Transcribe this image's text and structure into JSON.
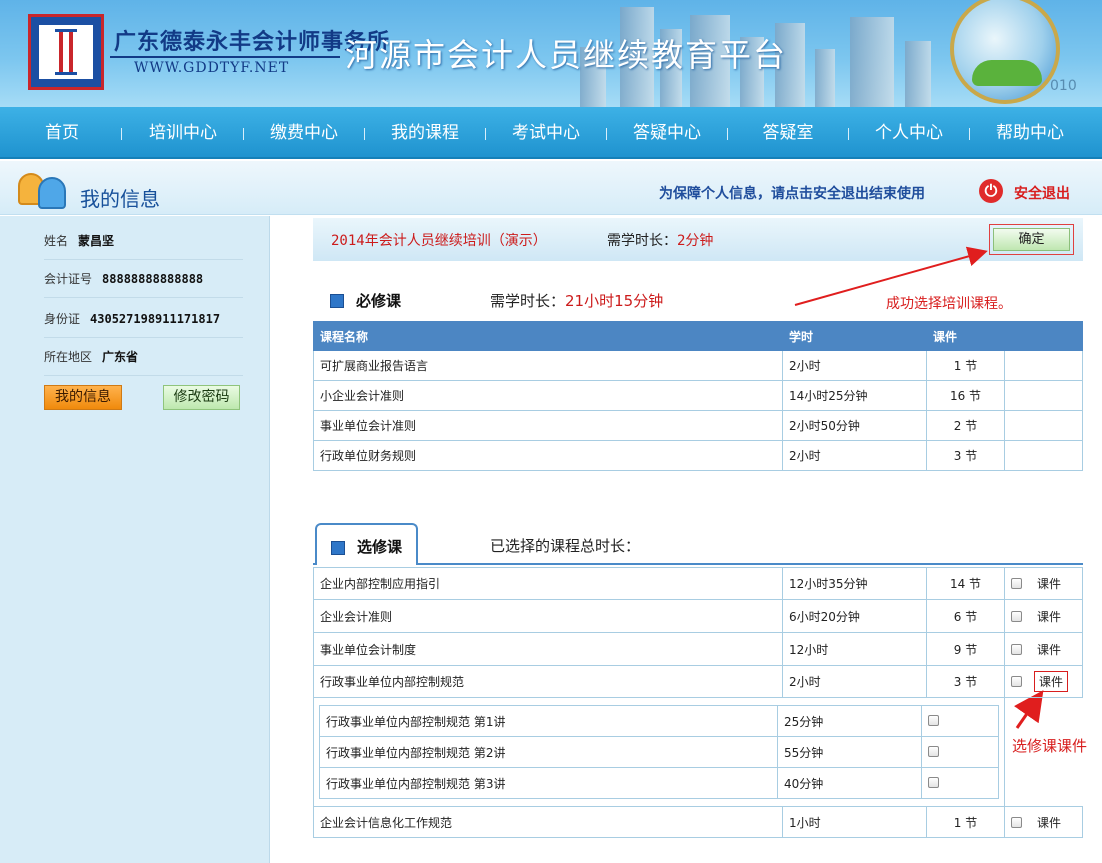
{
  "banner": {
    "company": "广东德泰永丰会计师事务所",
    "url": "WWW.GDDTYF.NET",
    "site_title": "河源市会计人员继续教育平台",
    "year_text": "010"
  },
  "nav": [
    "首页",
    "培训中心",
    "缴费中心",
    "我的课程",
    "考试中心",
    "答疑中心",
    "答疑室",
    "个人中心",
    "帮助中心"
  ],
  "header": {
    "title": "我的信息",
    "safe_tip": "为保障个人信息，请点击安全退出结束使用",
    "logout": "安全退出"
  },
  "profile": {
    "name_label": "姓名",
    "name": "蒙昌坚",
    "cert_label": "会计证号",
    "cert": "88888888888888",
    "id_label": "身份证",
    "id": "430527198911171817",
    "region_label": "所在地区",
    "region": "广东省",
    "btn_info": "我的信息",
    "btn_pwd": "修改密码"
  },
  "course": {
    "name": "2014年会计人员继续培训（演示）",
    "req_label": "需学时长：",
    "req_value": "2分钟",
    "confirm": "确定"
  },
  "required": {
    "title": "必修课",
    "req_label": "需学时长：",
    "req_value": "21小时15分钟",
    "headers": [
      "课程名称",
      "学时",
      "课件",
      ""
    ],
    "rows": [
      {
        "name": "可扩展商业报告语言",
        "hours": "2小时",
        "lessons": "1  节"
      },
      {
        "name": "小企业会计准则",
        "hours": "14小时25分钟",
        "lessons": "16  节"
      },
      {
        "name": "事业单位会计准则",
        "hours": "2小时50分钟",
        "lessons": "2  节"
      },
      {
        "name": "行政单位财务规则",
        "hours": "2小时",
        "lessons": "3  节"
      }
    ]
  },
  "annotations": {
    "success": "成功选择培训课程。",
    "elective": "选修课课件"
  },
  "elective": {
    "title": "选修课",
    "selected_label": "已选择的课程总时长：",
    "courseware": "课件",
    "rows": [
      {
        "name": "企业内部控制应用指引",
        "hours": "12小时35分钟",
        "lessons": "14 节"
      },
      {
        "name": "企业会计准则",
        "hours": "6小时20分钟",
        "lessons": "6 节"
      },
      {
        "name": "事业单位会计制度",
        "hours": "12小时",
        "lessons": "9 节"
      },
      {
        "name": "行政事业单位内部控制规范",
        "hours": "2小时",
        "lessons": "3 节"
      }
    ],
    "sub_rows": [
      {
        "name": "行政事业单位内部控制规范 第1讲",
        "duration": "25分钟"
      },
      {
        "name": "行政事业单位内部控制规范 第2讲",
        "duration": "55分钟"
      },
      {
        "name": "行政事业单位内部控制规范 第3讲",
        "duration": "40分钟"
      }
    ],
    "last_row": {
      "name": "企业会计信息化工作规范",
      "hours": "1小时",
      "lessons": "1 节"
    }
  },
  "colors": {
    "accent": "#1f93cf",
    "alert": "#d81e1e",
    "table_header": "#4c86c3"
  }
}
